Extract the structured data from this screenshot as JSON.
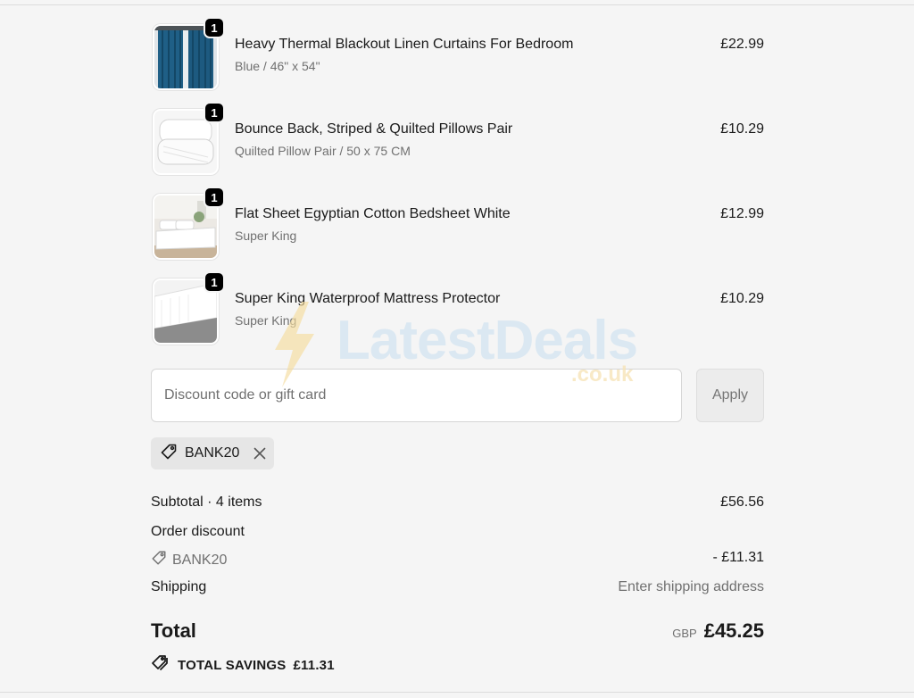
{
  "items": [
    {
      "title": "Heavy Thermal Blackout Linen Curtains For Bedroom",
      "variant": "Blue / 46\" x 54\"",
      "price": "£22.99",
      "qty": "1",
      "image": "curtains-image"
    },
    {
      "title": "Bounce Back, Striped & Quilted Pillows Pair",
      "variant": "Quilted Pillow Pair / 50 x 75 CM",
      "price": "£10.29",
      "qty": "1",
      "image": "pillows-image"
    },
    {
      "title": "Flat Sheet Egyptian Cotton Bedsheet White",
      "variant": "Super King",
      "price": "£12.99",
      "qty": "1",
      "image": "bedsheet-image"
    },
    {
      "title": "Super King Waterproof Mattress Protector",
      "variant": "Super King",
      "price": "£10.29",
      "qty": "1",
      "image": "mattress-protector-image"
    }
  ],
  "discount": {
    "placeholder": "Discount code or gift card",
    "apply_label": "Apply",
    "applied_code": "BANK20"
  },
  "totals": {
    "subtotal_label": "Subtotal · 4 items",
    "subtotal_value": "£56.56",
    "order_discount_label": "Order discount",
    "discount_code": "BANK20",
    "discount_value": "- £11.31",
    "shipping_label": "Shipping",
    "shipping_value": "Enter shipping address",
    "total_label": "Total",
    "total_currency": "GBP",
    "total_value": "£45.25",
    "savings_label": "TOTAL SAVINGS",
    "savings_value": "£11.31"
  },
  "watermark": {
    "text": "LatestDeals",
    "sub": ".co.uk"
  },
  "colors": {
    "background": "#f5f5f5",
    "badge": "#000000",
    "muted_text": "#707070"
  }
}
